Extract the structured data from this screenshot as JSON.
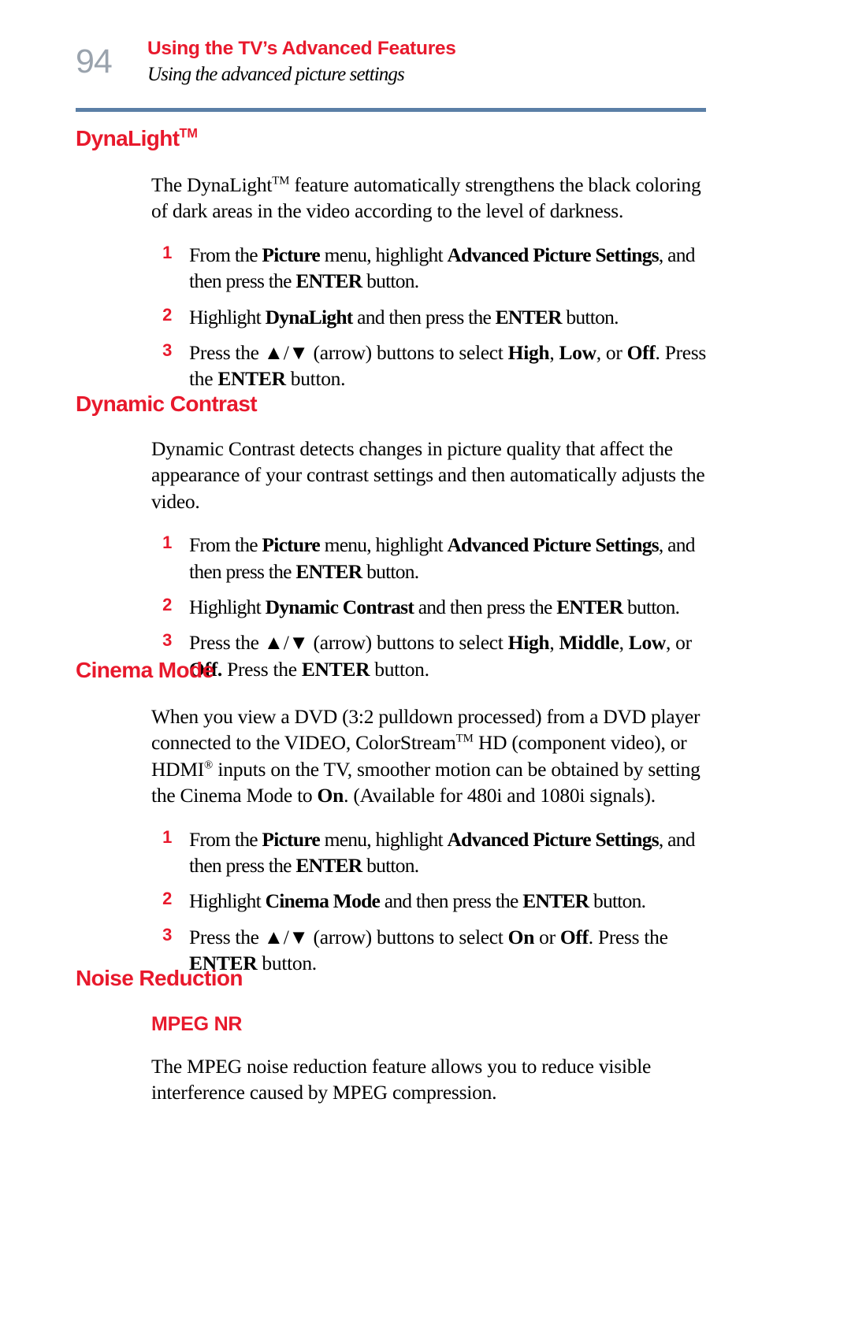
{
  "header": {
    "page_number": "94",
    "title": "Using the TV’s Advanced Features",
    "subtitle": "Using the advanced picture settings"
  },
  "sections": [
    {
      "heading": "DynaLight",
      "heading_sup": "TM",
      "intro": "The DynaLight™ feature automatically strengthens the black coloring of dark areas in the video according to the level of darkness.",
      "steps": [
        {
          "num": "1",
          "text": "From the Picture menu, highlight Advanced Picture Settings, and then press the ENTER button."
        },
        {
          "num": "2",
          "text": "Highlight DynaLight and then press the ENTER button."
        },
        {
          "num": "3",
          "text": "Press the ▲/▼ (arrow) buttons to select High, Low, or Off. Press the ENTER button."
        }
      ]
    },
    {
      "heading": "Dynamic Contrast",
      "intro": "Dynamic Contrast detects changes in picture quality that affect the appearance of your contrast settings and then automatically adjusts the video.",
      "steps": [
        {
          "num": "1",
          "text": "From the Picture menu, highlight Advanced Picture Settings, and then press the ENTER button."
        },
        {
          "num": "2",
          "text": "Highlight Dynamic Contrast and then press the ENTER button."
        },
        {
          "num": "3",
          "text": "Press the ▲/▼ (arrow) buttons to select High, Middle, Low, or Off. Press the ENTER button."
        }
      ]
    },
    {
      "heading": "Cinema Mode",
      "intro": "When you view a DVD (3:2 pulldown processed) from a DVD player connected to the VIDEO, ColorStream™ HD (component video), or HDMI® inputs on the TV, smoother motion can be obtained by setting the Cinema Mode to On. (Available for 480i and 1080i signals).",
      "steps": [
        {
          "num": "1",
          "text": "From the Picture menu, highlight Advanced Picture Settings, and then press the ENTER button."
        },
        {
          "num": "2",
          "text": "Highlight Cinema Mode and then press the ENTER button."
        },
        {
          "num": "3",
          "text": "Press the ▲/▼ (arrow) buttons to select On or Off. Press the ENTER button."
        }
      ]
    },
    {
      "heading": "Noise Reduction",
      "subheading": "MPEG NR",
      "intro": "The MPEG noise reduction feature allows you to reduce visible interference caused by MPEG compression."
    }
  ],
  "colors": {
    "accent_red": "#e8192c",
    "rule_blue": "#5b7fa6",
    "page_number_gray": "#9aa3ad"
  }
}
